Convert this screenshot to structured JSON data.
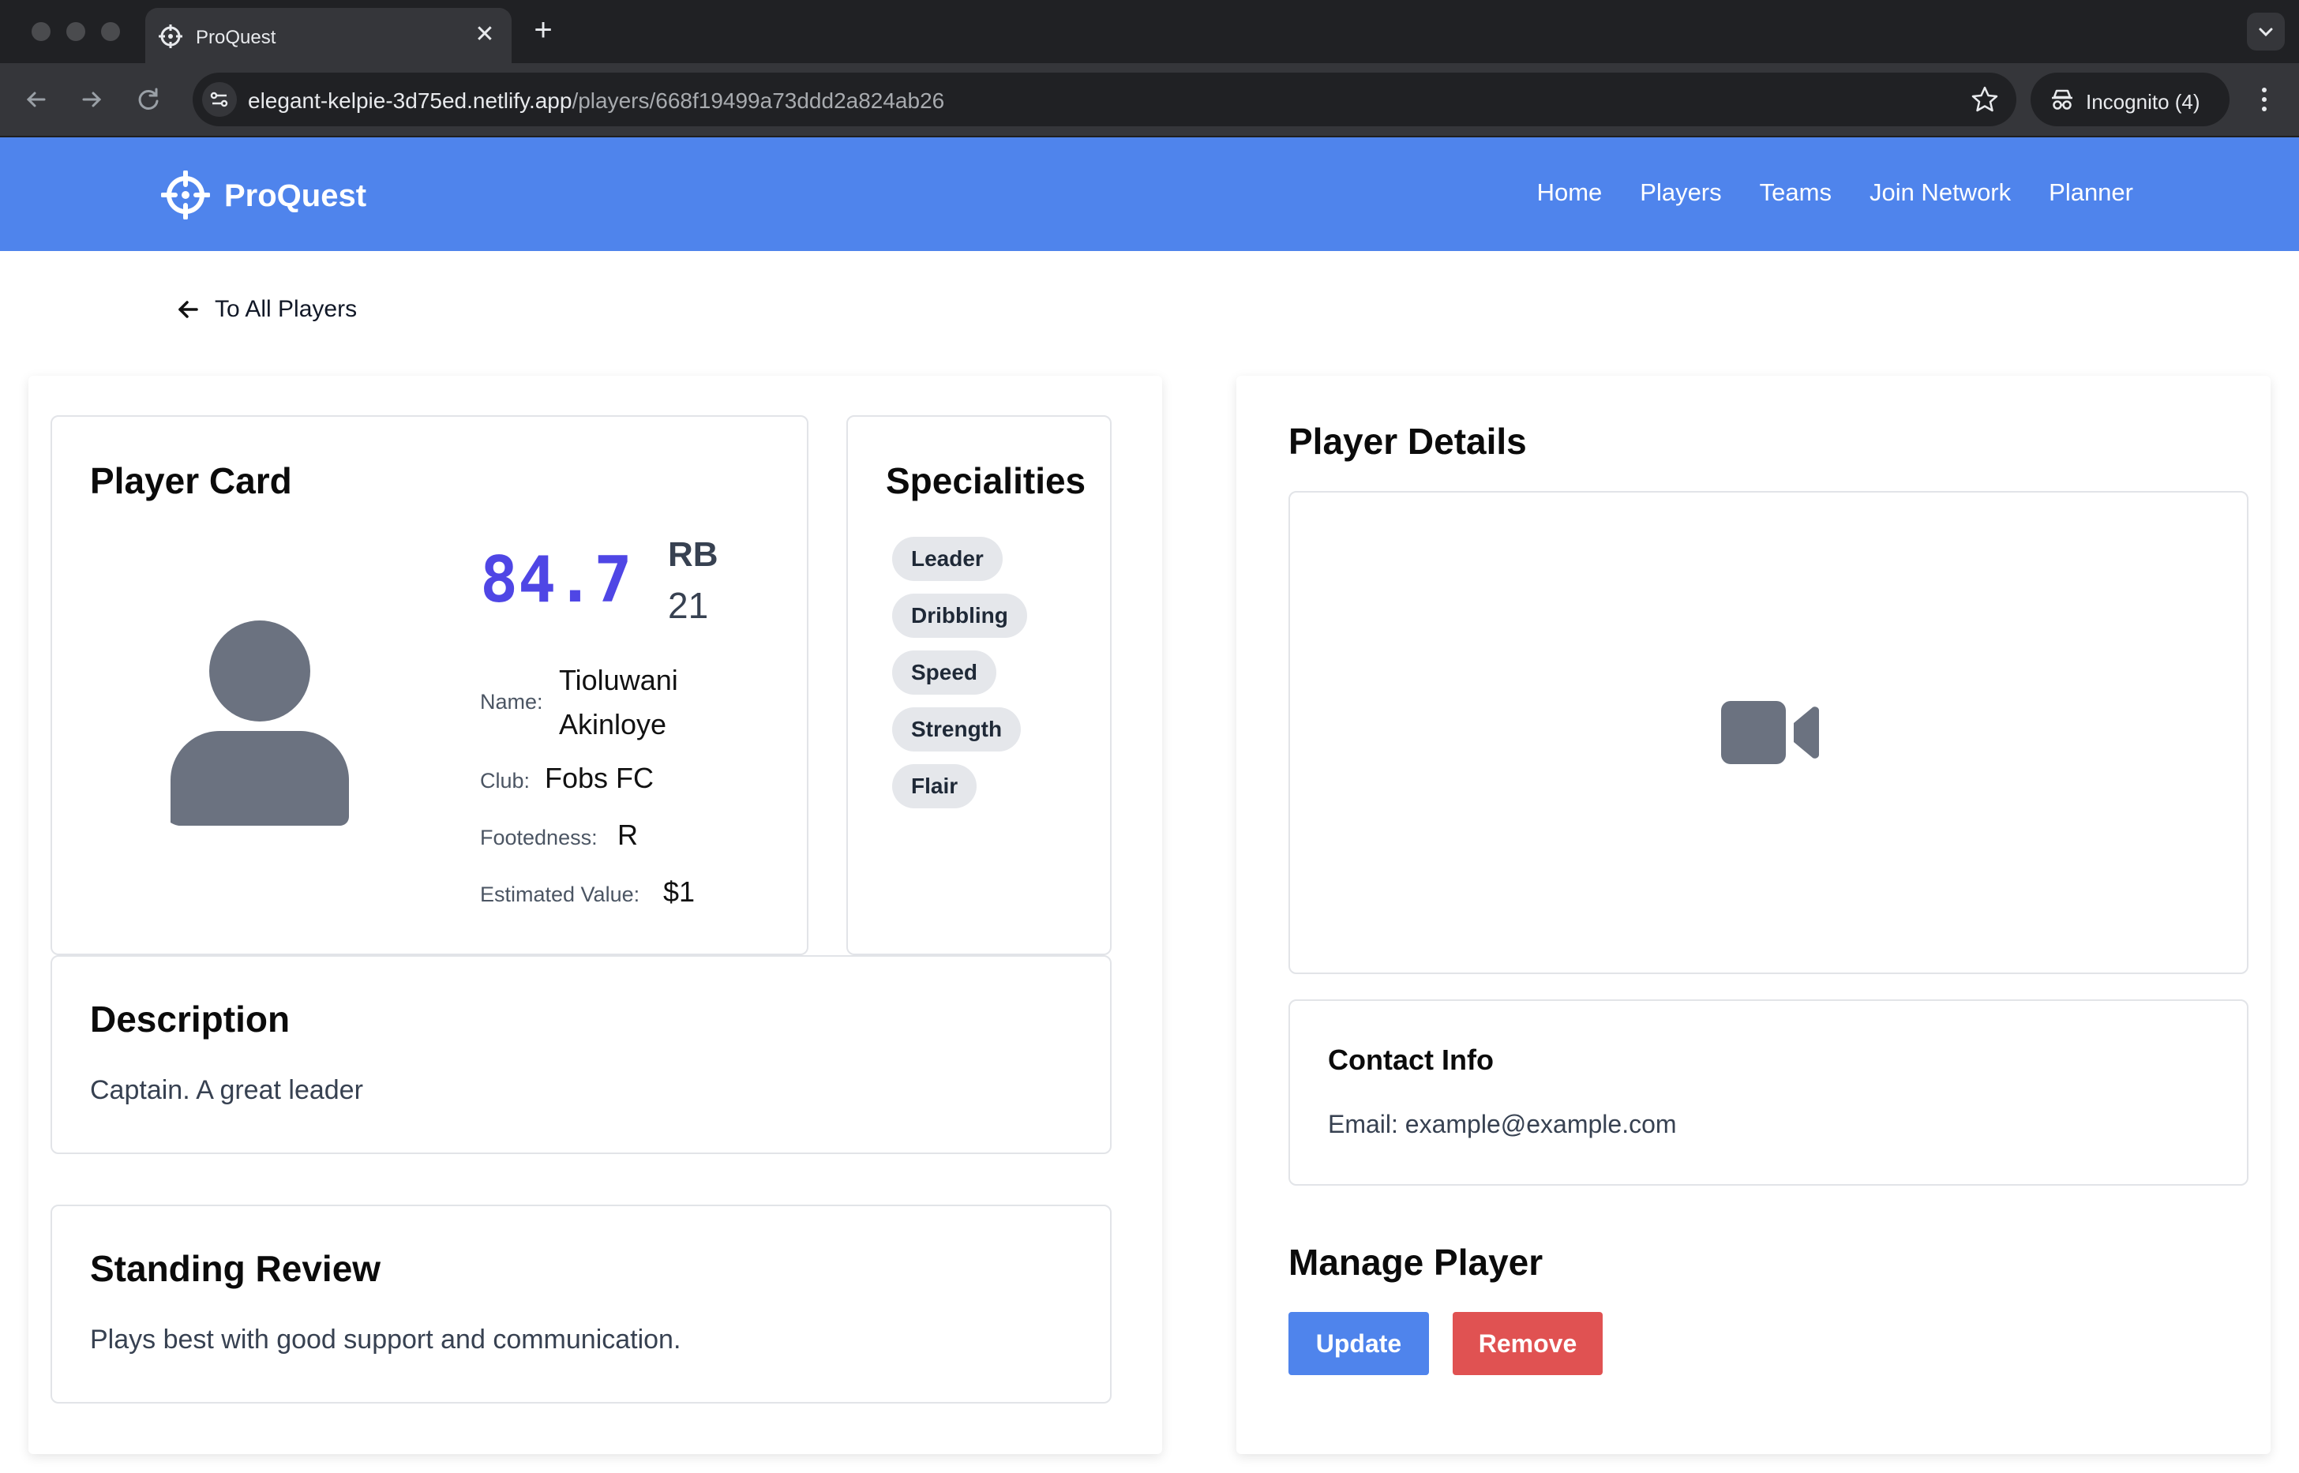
{
  "browser": {
    "tab_title": "ProQuest",
    "tab_close": "✕",
    "new_tab": "+",
    "url_host": "elegant-kelpie-3d75ed.netlify.app",
    "url_path": "/players/668f19499a73ddd2a824ab26",
    "incognito_label": "Incognito (4)"
  },
  "nav": {
    "brand": "ProQuest",
    "links": [
      "Home",
      "Players",
      "Teams",
      "Join Network",
      "Planner"
    ]
  },
  "back_link": "To All Players",
  "player_card": {
    "title": "Player Card",
    "rating": "84.7",
    "position": "RB",
    "age": "21",
    "name_label": "Name:",
    "name_line1": "Tioluwani",
    "name_line2": "Akinloye",
    "club_label": "Club:",
    "club": "Fobs FC",
    "foot_label": "Footedness:",
    "foot": "R",
    "value_label": "Estimated Value:",
    "value": "$1"
  },
  "specialities": {
    "title": "Specialities",
    "items": [
      "Leader",
      "Dribbling",
      "Speed",
      "Strength",
      "Flair"
    ]
  },
  "description": {
    "title": "Description",
    "text": "Captain. A great leader"
  },
  "standing_review": {
    "title": "Standing Review",
    "text": "Plays best with good support and communication."
  },
  "player_details": {
    "title": "Player Details",
    "video_icon": "video-camera-icon"
  },
  "contact": {
    "title": "Contact Info",
    "email_text": "Email: example@example.com"
  },
  "manage": {
    "title": "Manage Player",
    "update_label": "Update",
    "remove_label": "Remove"
  },
  "colors": {
    "nav_bg": "#4f84ec",
    "rating": "#4f46e5",
    "update_btn": "#4f84ec",
    "remove_btn": "#e05252",
    "chip_bg": "#e5e7eb",
    "icon_gray": "#6b7280"
  }
}
